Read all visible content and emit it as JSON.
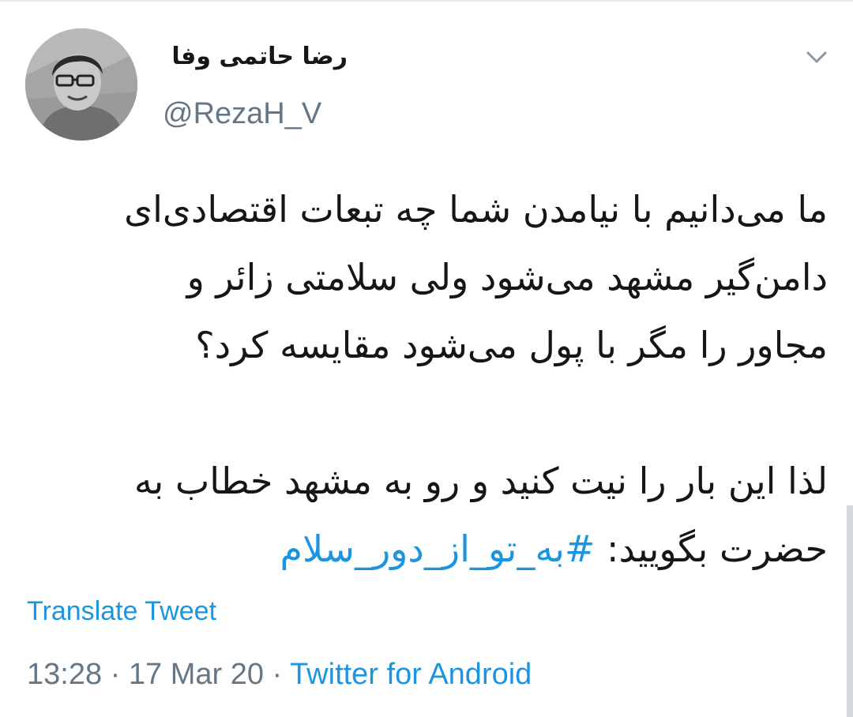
{
  "tweet": {
    "author": {
      "display_name": "رضا حاتمی وفا",
      "handle": "@RezaH_V",
      "avatar_icon": "user-avatar"
    },
    "text_lines": [
      "ما می‌دانیم با نیامدن شما چه تبعات اقتصادی‌ای",
      "دامن‌گیر مشهد می‌شود ولی سلامتی زائر و",
      "مجاور را مگر با پول می‌شود مقایسه کرد؟",
      "",
      "لذا این بار را نیت کنید و رو به مشهد خطاب به"
    ],
    "last_line_text": "حضرت بگویید: ",
    "hashtag": "#به_تو_از_دور_سلام",
    "translate_label": "Translate Tweet",
    "time": "13:28",
    "separator": "·",
    "date": "17 Mar 20",
    "source": "Twitter for Android",
    "menu_icon": "chevron-down-icon",
    "colors": {
      "link": "#1b95e0",
      "secondary": "#657786",
      "primary_text": "#14171a"
    }
  }
}
